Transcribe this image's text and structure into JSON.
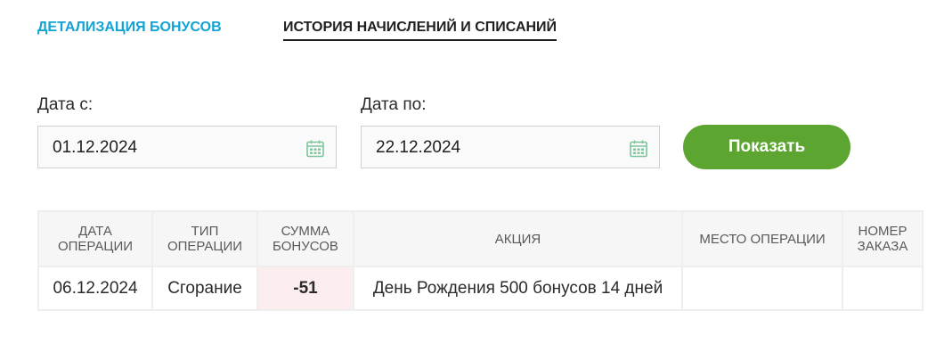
{
  "tabs": {
    "details": "ДЕТАЛИЗАЦИЯ БОНУСОВ",
    "history": "ИСТОРИЯ НАЧИСЛЕНИЙ И СПИСАНИЙ",
    "active": "history"
  },
  "filters": {
    "from_label": "Дата с:",
    "from_value": "01.12.2024",
    "to_label": "Дата по:",
    "to_value": "22.12.2024",
    "show_button": "Показать",
    "calendar_icon": "calendar-icon"
  },
  "table": {
    "headers": {
      "date": [
        "ДАТА",
        "ОПЕРАЦИИ"
      ],
      "type": [
        "ТИП",
        "ОПЕРАЦИИ"
      ],
      "amount": [
        "СУММА",
        "БОНУСОВ"
      ],
      "promo": "АКЦИЯ",
      "place": "МЕСТО ОПЕРАЦИИ",
      "order": [
        "НОМЕР",
        "ЗАКАЗА"
      ]
    },
    "rows": [
      {
        "date": "06.12.2024",
        "type": "Сгорание",
        "amount": "-51",
        "promo": "День Рождения 500 бонусов 14 дней",
        "place": "",
        "order": ""
      }
    ]
  },
  "colors": {
    "tab_accent": "#11a3d4",
    "button": "#5da531",
    "negative_amount": "#e2522f",
    "negative_amount_bg": "#fceeee",
    "calendar_icon": "#7cc59b"
  }
}
